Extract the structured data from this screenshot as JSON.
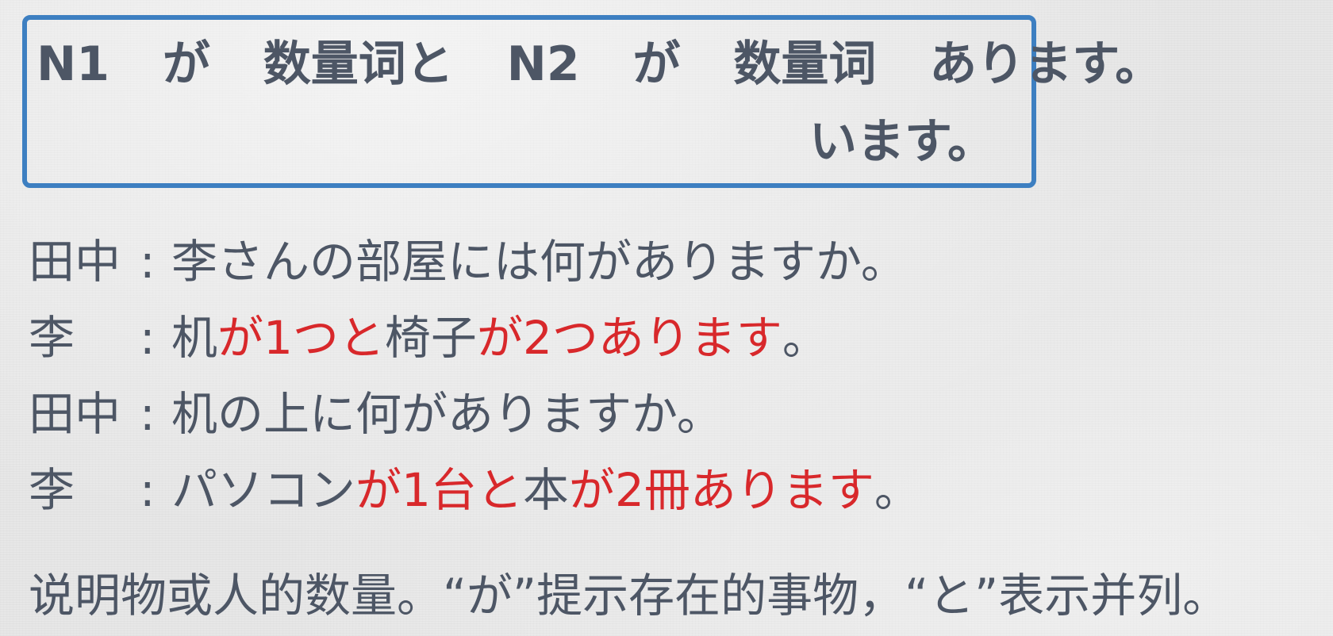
{
  "pattern": {
    "line1": [
      "N1",
      "が",
      "数量词と",
      "N2",
      "が",
      "数量词",
      "あります。"
    ],
    "line2": "います。"
  },
  "dialogue": [
    {
      "speaker": "田中",
      "colon": ":",
      "segments": [
        {
          "text": "李さんの部屋には何がありますか。",
          "red": false
        }
      ]
    },
    {
      "speaker": "李",
      "colon": ":",
      "segments": [
        {
          "text": "机",
          "red": false
        },
        {
          "text": "が1つと",
          "red": true
        },
        {
          "text": "椅子",
          "red": false
        },
        {
          "text": "が2つあります",
          "red": true
        },
        {
          "text": "。",
          "red": false
        }
      ]
    },
    {
      "speaker": "田中",
      "colon": ":",
      "segments": [
        {
          "text": "机の上に何がありますか。",
          "red": false
        }
      ]
    },
    {
      "speaker": "李",
      "colon": ":",
      "segments": [
        {
          "text": "パソコン",
          "red": false
        },
        {
          "text": "が1台と",
          "red": true
        },
        {
          "text": "本",
          "red": false
        },
        {
          "text": "が2冊あります",
          "red": true
        },
        {
          "text": "。",
          "red": false
        }
      ]
    }
  ],
  "note": "说明物或人的数量。“が”提示存在的事物，“と”表示并列。",
  "colors": {
    "text": "#4d5665",
    "highlight": "#d8282b",
    "box_border": "#3d7fc1"
  }
}
